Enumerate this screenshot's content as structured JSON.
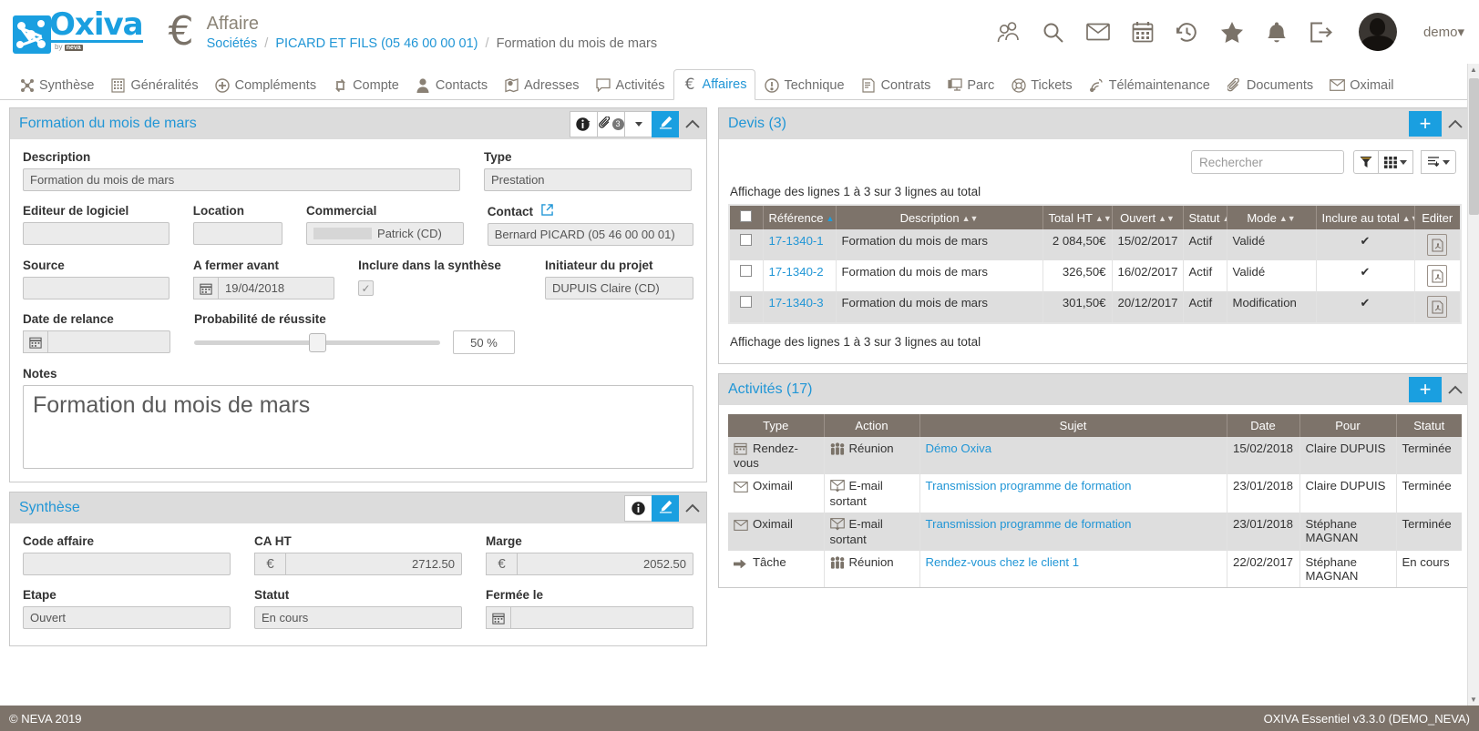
{
  "brand": {
    "name": "Oxiva",
    "sub_by": "by",
    "sub_name": "neva",
    "accent": "#1a9fe0"
  },
  "header": {
    "module_title": "Affaire",
    "breadcrumb": [
      {
        "label": "Sociétés",
        "link": true
      },
      {
        "label": "PICARD ET FILS (05 46 00 00 01)",
        "link": true
      },
      {
        "label": "Formation du mois de mars",
        "link": false
      }
    ],
    "separator": "/",
    "icons": [
      "users-icon",
      "search-icon",
      "mail-icon",
      "calendar-icon",
      "history-icon",
      "star-icon",
      "bell-icon",
      "logout-icon"
    ],
    "user": "demo",
    "user_caret": "▾"
  },
  "tabs": [
    {
      "label": "Synthèse",
      "icon": "network-icon",
      "active": false
    },
    {
      "label": "Généralités",
      "icon": "building-icon",
      "active": false
    },
    {
      "label": "Compléments",
      "icon": "plus-circle-icon",
      "active": false
    },
    {
      "label": "Compte",
      "icon": "exchange-icon",
      "active": false
    },
    {
      "label": "Contacts",
      "icon": "person-icon",
      "active": false
    },
    {
      "label": "Adresses",
      "icon": "map-marker-icon",
      "active": false
    },
    {
      "label": "Activités",
      "icon": "comment-icon",
      "active": false
    },
    {
      "label": "Affaires",
      "icon": "euro-icon",
      "active": true
    },
    {
      "label": "Technique",
      "icon": "exclamation-circle-icon",
      "active": false
    },
    {
      "label": "Contrats",
      "icon": "contract-icon",
      "active": false
    },
    {
      "label": "Parc",
      "icon": "monitor-icon",
      "active": false
    },
    {
      "label": "Tickets",
      "icon": "support-icon",
      "active": false
    },
    {
      "label": "Télémaintenance",
      "icon": "broadcast-icon",
      "active": false
    },
    {
      "label": "Documents",
      "icon": "paperclip-icon",
      "active": false
    },
    {
      "label": "Oximail",
      "icon": "envelope-icon",
      "active": false
    }
  ],
  "affaire_panel": {
    "title": "Formation du mois de mars",
    "actions": {
      "info": "info-icon",
      "attach": "paperclip-icon",
      "attach_count": "3",
      "dropdown": "caret-down-icon",
      "edit": "pencil-icon",
      "collapse": "chevron-up-icon"
    },
    "fields": {
      "description_label": "Description",
      "description_value": "Formation du mois de mars",
      "type_label": "Type",
      "type_value": "Prestation",
      "editeur_label": "Editeur de logiciel",
      "editeur_value": "",
      "location_label": "Location",
      "location_value": "",
      "commercial_label": "Commercial",
      "commercial_value": "Patrick (CD)",
      "contact_label": "Contact",
      "contact_value": "Bernard PICARD (05 46 00 00 01)",
      "source_label": "Source",
      "source_value": "",
      "fermer_label": "A fermer avant",
      "fermer_value": "19/04/2018",
      "inclure_label": "Inclure dans la synthèse",
      "inclure_checked": "✓",
      "initiateur_label": "Initiateur du projet",
      "initiateur_value": "DUPUIS Claire (CD)",
      "relance_label": "Date de relance",
      "relance_value": "",
      "proba_label": "Probabilité de réussite",
      "proba_value": "50 %",
      "proba_percent": 50,
      "notes_label": "Notes",
      "notes_value": "Formation du mois de mars"
    }
  },
  "synthese_panel": {
    "title": "Synthèse",
    "actions": {
      "info": "info-icon",
      "edit": "pencil-icon",
      "collapse": "chevron-up-icon"
    },
    "fields": {
      "code_label": "Code affaire",
      "code_value": "",
      "ca_label": "CA HT",
      "ca_value": "2712.50",
      "marge_label": "Marge",
      "marge_value": "2052.50",
      "etape_label": "Etape",
      "etape_value": "Ouvert",
      "statut_label": "Statut",
      "statut_value": "En cours",
      "fermee_label": "Fermée le",
      "fermee_value": "",
      "currency": "€"
    }
  },
  "devis_panel": {
    "title": "Devis (3)",
    "add_label": "+",
    "collapse": "chevron-up-icon",
    "search_placeholder": "Rechercher",
    "tools": [
      "filter-icon",
      "columns-icon",
      "export-icon"
    ],
    "info_top": "Affichage des lignes 1 à 3 sur 3 lignes au total",
    "info_bottom": "Affichage des lignes 1 à 3 sur 3 lignes au total",
    "columns": [
      "",
      "Référence",
      "Description",
      "Total HT",
      "Ouvert",
      "Statut",
      "Mode",
      "Inclure au total",
      "Editer"
    ],
    "rows": [
      {
        "ref": "17-1340-1",
        "description": "Formation du mois de mars",
        "total": "2 084,50€",
        "ouvert": "15/02/2017",
        "statut": "Actif",
        "mode": "Validé",
        "inclure": "✔",
        "editer": "pdf-icon"
      },
      {
        "ref": "17-1340-2",
        "description": "Formation du mois de mars",
        "total": "326,50€",
        "ouvert": "16/02/2017",
        "statut": "Actif",
        "mode": "Validé",
        "inclure": "✔",
        "editer": "pdf-icon"
      },
      {
        "ref": "17-1340-3",
        "description": "Formation du mois de mars",
        "total": "301,50€",
        "ouvert": "20/12/2017",
        "statut": "Actif",
        "mode": "Modification",
        "inclure": "✔",
        "editer": "pdf-icon"
      }
    ]
  },
  "activites_panel": {
    "title": "Activités (17)",
    "add_label": "+",
    "collapse": "chevron-up-icon",
    "columns": [
      "Type",
      "Action",
      "Sujet",
      "Date",
      "Pour",
      "Statut"
    ],
    "rows": [
      {
        "type": "Rendez-vous",
        "type_icon": "appointment-icon",
        "action": "Réunion",
        "action_icon": "group-icon",
        "sujet": "Démo Oxiva",
        "date": "15/02/2018",
        "pour": "Claire DUPUIS",
        "statut": "Terminée"
      },
      {
        "type": "Oximail",
        "type_icon": "envelope-icon",
        "action": "E-mail sortant",
        "action_icon": "envelope-out-icon",
        "sujet": "Transmission programme de formation",
        "date": "23/01/2018",
        "pour": "Claire DUPUIS",
        "statut": "Terminée"
      },
      {
        "type": "Oximail",
        "type_icon": "envelope-icon",
        "action": "E-mail sortant",
        "action_icon": "envelope-out-icon",
        "sujet": "Transmission programme de formation",
        "date": "23/01/2018",
        "pour": "Stéphane MAGNAN",
        "statut": "Terminée"
      },
      {
        "type": "Tâche",
        "type_icon": "arrow-right-icon",
        "action": "Réunion",
        "action_icon": "group-icon",
        "sujet": "Rendez-vous chez le client 1",
        "date": "22/02/2017",
        "pour": "Stéphane MAGNAN",
        "statut": "En cours"
      }
    ]
  },
  "footer": {
    "left": "© NEVA 2019",
    "right": "OXIVA Essentiel v3.3.0 (DEMO_NEVA)"
  }
}
